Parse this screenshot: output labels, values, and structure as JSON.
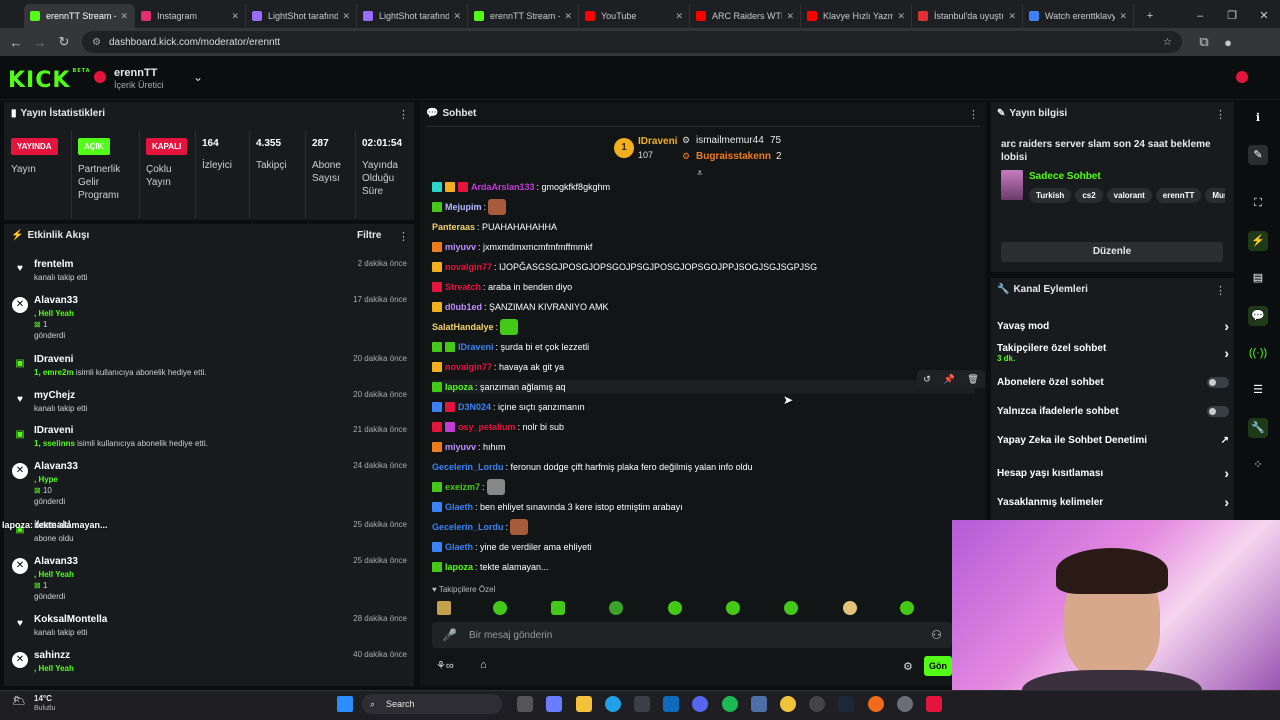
{
  "browser": {
    "tabs": [
      {
        "title": "erennTT Stream -",
        "color": "#53fc18"
      },
      {
        "title": "Instagram",
        "color": "#e1306c"
      },
      {
        "title": "LightShot tarafınd",
        "color": "#9b6cff"
      },
      {
        "title": "LightShot tarafınd",
        "color": "#9b6cff"
      },
      {
        "title": "erennTT Stream -",
        "color": "#53fc18"
      },
      {
        "title": "YouTube",
        "color": "#ff0000"
      },
      {
        "title": "ARC Raiders WTF",
        "color": "#ff0000"
      },
      {
        "title": "Klavye Hızlı Yazm",
        "color": "#ff0000"
      },
      {
        "title": "İstanbul'da uyuştı",
        "color": "#e03030"
      },
      {
        "title": "Watch erenttklavy",
        "color": "#3b82f6"
      }
    ],
    "url": "dashboard.kick.com/moderator/erenntt"
  },
  "header": {
    "logo": "KICK",
    "logo_badge": "BETA",
    "user": "erennTT",
    "role": "İçerik Üretici"
  },
  "stats": {
    "title": "Yayın İstatistikleri",
    "items": [
      {
        "badge": "YAYINDA",
        "badge_color": "#e3143d",
        "label": "Yayın"
      },
      {
        "badge": "AÇIK",
        "badge_color": "#53fc18",
        "label": "Partnerlik Gelir Programı"
      },
      {
        "badge": "KAPALI",
        "badge_color": "#e3143d",
        "label": "Çoklu Yayın"
      },
      {
        "value": "164",
        "label": "İzleyici"
      },
      {
        "value": "4.355",
        "label": "Takipçi"
      },
      {
        "value": "287",
        "label": "Abone Sayısı"
      },
      {
        "value": "02:01:54",
        "label": "Yayında Olduğu Süre"
      }
    ]
  },
  "activity": {
    "title": "Etkinlik Akışı",
    "filter": "Filtre",
    "items": [
      {
        "name": "frentelm",
        "time": "2 dakika önce",
        "line1": "kanalı takip etti",
        "icon": "heart"
      },
      {
        "name": "Alavan33",
        "time": "17 dakika önce",
        "green": ", Hell Yeah",
        "count": "1",
        "line2": "gönderdi",
        "icon": "kick"
      },
      {
        "name": "IDraveni",
        "time": "20 dakika önce",
        "greenPre": "1, emre2m",
        "line1": " isimli kullanıcıya abonelik hediye etti.",
        "icon": "gift"
      },
      {
        "name": "myChejz",
        "time": "20 dakika önce",
        "line1": "kanalı takip etti",
        "icon": "heart"
      },
      {
        "name": "IDraveni",
        "time": "21 dakika önce",
        "greenPre": "1, sselinns",
        "line1": " isimli kullanıcıya abonelik hediye etti.",
        "icon": "gift"
      },
      {
        "name": "Alavan33",
        "time": "24 dakika önce",
        "green": ", Hype",
        "count": "10",
        "line2": "gönderdi",
        "icon": "kick"
      },
      {
        "name": "ileanakl",
        "time": "25 dakika önce",
        "line1": "abone oldu",
        "icon": "gift",
        "overlay": "lapoza: tekte alamayan..."
      },
      {
        "name": "Alavan33",
        "time": "25 dakika önce",
        "green": ", Hell Yeah",
        "count": "1",
        "line2": "gönderdi",
        "icon": "kick"
      },
      {
        "name": "KoksalMontella",
        "time": "28 dakika önce",
        "line1": "kanalı takip etti",
        "icon": "heart"
      },
      {
        "name": "sahinzz",
        "time": "40 dakika önce",
        "green": ", Hell Yeah",
        "icon": "kick"
      }
    ]
  },
  "chat": {
    "title": "Sohbet",
    "top_gifters": [
      {
        "rank": "1",
        "name": "IDraveni",
        "count": "107"
      },
      {
        "name": "ismailmemur44",
        "count": "75"
      },
      {
        "name": "Bugraisstakenn",
        "count": "2"
      }
    ],
    "messages": [
      {
        "user": "ArdaArslan133",
        "color": "#c13bd4",
        "text": ": gmogkfkf8gkghm",
        "badges": [
          "#2bd6c8",
          "#f2b01e",
          "#e3143d"
        ]
      },
      {
        "user": "Mejupim",
        "color": "#b5b9ff",
        "text": ":",
        "badges": [
          "#45c919"
        ],
        "emote": "#a85b3b"
      },
      {
        "user": "Panteraas",
        "color": "#f5d36b",
        "text": ": PUAHAHAHAHHA",
        "badges": []
      },
      {
        "user": "miyuvv",
        "color": "#c08cff",
        "text": ": jxmxmdmxmcmfmfmffmmkf",
        "badges": [
          "#f07d1d"
        ]
      },
      {
        "user": "novalgin77",
        "color": "#e3143d",
        "text": ": IJOPĞASGSGJPOSGJOPSGOJPSGJPOSGJOPSGOJPPJSOGJSGJSGPJSG",
        "badges": [
          "#f2b01e"
        ]
      },
      {
        "user": "Streatch",
        "color": "#e3143d",
        "text": ": araba in benden diyo",
        "badges": [
          "#e3143d"
        ]
      },
      {
        "user": "d0ub1ed",
        "color": "#c08cff",
        "text": ": ŞANZIMAN KIVRANIYO AMK",
        "badges": [
          "#f2b01e"
        ]
      },
      {
        "user": "SalatHandalye",
        "color": "#f5d36b",
        "text": ":",
        "badges": [],
        "emote": "#45c919"
      },
      {
        "user": "IDraveni",
        "color": "#3b82f6",
        "text": ": şurda bi et çok lezzetli",
        "badges": [
          "#45c919",
          "#45c919"
        ]
      },
      {
        "user": "novalgin77",
        "color": "#e3143d",
        "text": ": havaya ak git ya",
        "badges": [
          "#f2b01e"
        ]
      },
      {
        "user": "lapoza",
        "color": "#53fc18",
        "text": ": şanzıman ağlamış aq",
        "badges": [
          "#45c919"
        ]
      },
      {
        "user": "D3N024",
        "color": "#3b82f6",
        "text": ": içine sıçtı şanzımanın",
        "badges": [
          "#3b82f6",
          "#e3143d"
        ]
      },
      {
        "user": "osy_petalium",
        "color": "#e3143d",
        "text": ": nolr bi sub",
        "badges": [
          "#e3143d",
          "#c13bd4"
        ]
      },
      {
        "user": "miyuvv",
        "color": "#c08cff",
        "text": ": hıhım",
        "badges": [
          "#f07d1d"
        ]
      },
      {
        "user": "Gecelerin_Lordu",
        "color": "#3b82f6",
        "text": ": feronun dodge çift harfmiş plaka fero değilmiş yalan info oldu",
        "badges": []
      },
      {
        "user": "exeizm7",
        "color": "#45c919",
        "text": ":",
        "badges": [
          "#45c919"
        ],
        "emote": "#888888"
      },
      {
        "user": "Glaeth",
        "color": "#3b82f6",
        "text": ": ben ehliyet sınavında 3 kere istop etmiştim arabayı",
        "badges": [
          "#3b82f6"
        ]
      },
      {
        "user": "Gecelerin_Lordu",
        "color": "#3b82f6",
        "text": ":",
        "badges": [],
        "emote": "#a85b3b"
      },
      {
        "user": "Glaeth",
        "color": "#3b82f6",
        "text": ": yine de verdiler ama ehliyeti",
        "badges": [
          "#3b82f6"
        ]
      },
      {
        "user": "lapoza",
        "color": "#53fc18",
        "text": ": tekte alamayan...",
        "badges": [
          "#45c919"
        ]
      }
    ],
    "followers_only": "Takipçilere Özel",
    "input_placeholder": "Bir mesaj gönderin",
    "send_label": "Gön"
  },
  "stream_info": {
    "title": "Yayın bilgisi",
    "stream_title": "arc raiders server slam son 24 saat bekleme lobisi",
    "category": "Sadece Sohbet",
    "tags": [
      "Turkish",
      "cs2",
      "valorant",
      "erennTT",
      "Music"
    ],
    "edit": "Düzenle"
  },
  "channel_actions": {
    "title": "Kanal Eylemleri",
    "items": [
      {
        "label": "Yavaş mod",
        "type": "chevron"
      },
      {
        "label": "Takipçilere özel sohbet",
        "sub": "3 dk.",
        "type": "chevron"
      },
      {
        "label": "Abonelere özel sohbet",
        "type": "toggle"
      },
      {
        "label": "Yalnızca ifadelerle sohbet",
        "type": "toggle"
      },
      {
        "label": "Yapay Zeka ile Sohbet Denetimi",
        "type": "external"
      },
      {
        "label": "Hesap yaşı kısıtlaması",
        "type": "chevron"
      },
      {
        "label": "Yasaklanmış kelimeler",
        "type": "chevron"
      }
    ]
  },
  "taskbar": {
    "weather_temp": "14°C",
    "weather_desc": "Bulutlu",
    "search": "Search"
  }
}
